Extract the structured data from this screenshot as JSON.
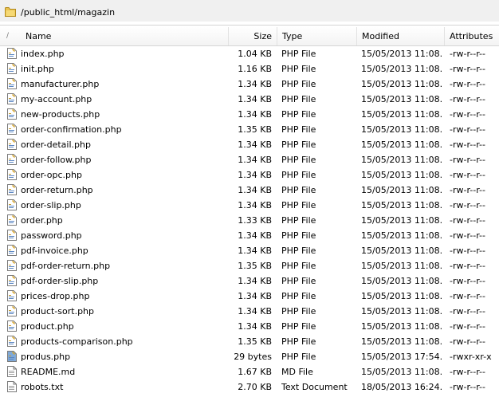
{
  "path": "/public_html/magazin",
  "columns": {
    "name": "Name",
    "size": "Size",
    "type": "Type",
    "modified": "Modified",
    "attributes": "Attributes"
  },
  "files": [
    {
      "name": "index.php",
      "size": "1.04 KB",
      "type": "PHP File",
      "modified": "15/05/2013 11:08...",
      "attributes": "-rw-r--r--",
      "icon": "php-file-icon"
    },
    {
      "name": "init.php",
      "size": "1.16 KB",
      "type": "PHP File",
      "modified": "15/05/2013 11:08...",
      "attributes": "-rw-r--r--",
      "icon": "php-file-icon"
    },
    {
      "name": "manufacturer.php",
      "size": "1.34 KB",
      "type": "PHP File",
      "modified": "15/05/2013 11:08...",
      "attributes": "-rw-r--r--",
      "icon": "php-file-icon"
    },
    {
      "name": "my-account.php",
      "size": "1.34 KB",
      "type": "PHP File",
      "modified": "15/05/2013 11:08...",
      "attributes": "-rw-r--r--",
      "icon": "php-file-icon"
    },
    {
      "name": "new-products.php",
      "size": "1.34 KB",
      "type": "PHP File",
      "modified": "15/05/2013 11:08...",
      "attributes": "-rw-r--r--",
      "icon": "php-file-icon"
    },
    {
      "name": "order-confirmation.php",
      "size": "1.35 KB",
      "type": "PHP File",
      "modified": "15/05/2013 11:08...",
      "attributes": "-rw-r--r--",
      "icon": "php-file-icon"
    },
    {
      "name": "order-detail.php",
      "size": "1.34 KB",
      "type": "PHP File",
      "modified": "15/05/2013 11:08...",
      "attributes": "-rw-r--r--",
      "icon": "php-file-icon"
    },
    {
      "name": "order-follow.php",
      "size": "1.34 KB",
      "type": "PHP File",
      "modified": "15/05/2013 11:08...",
      "attributes": "-rw-r--r--",
      "icon": "php-file-icon"
    },
    {
      "name": "order-opc.php",
      "size": "1.34 KB",
      "type": "PHP File",
      "modified": "15/05/2013 11:08...",
      "attributes": "-rw-r--r--",
      "icon": "php-file-icon"
    },
    {
      "name": "order-return.php",
      "size": "1.34 KB",
      "type": "PHP File",
      "modified": "15/05/2013 11:08...",
      "attributes": "-rw-r--r--",
      "icon": "php-file-icon"
    },
    {
      "name": "order-slip.php",
      "size": "1.34 KB",
      "type": "PHP File",
      "modified": "15/05/2013 11:08...",
      "attributes": "-rw-r--r--",
      "icon": "php-file-icon"
    },
    {
      "name": "order.php",
      "size": "1.33 KB",
      "type": "PHP File",
      "modified": "15/05/2013 11:08...",
      "attributes": "-rw-r--r--",
      "icon": "php-file-icon"
    },
    {
      "name": "password.php",
      "size": "1.34 KB",
      "type": "PHP File",
      "modified": "15/05/2013 11:08...",
      "attributes": "-rw-r--r--",
      "icon": "php-file-icon"
    },
    {
      "name": "pdf-invoice.php",
      "size": "1.34 KB",
      "type": "PHP File",
      "modified": "15/05/2013 11:08...",
      "attributes": "-rw-r--r--",
      "icon": "php-file-icon"
    },
    {
      "name": "pdf-order-return.php",
      "size": "1.35 KB",
      "type": "PHP File",
      "modified": "15/05/2013 11:08...",
      "attributes": "-rw-r--r--",
      "icon": "php-file-icon"
    },
    {
      "name": "pdf-order-slip.php",
      "size": "1.34 KB",
      "type": "PHP File",
      "modified": "15/05/2013 11:08...",
      "attributes": "-rw-r--r--",
      "icon": "php-file-icon"
    },
    {
      "name": "prices-drop.php",
      "size": "1.34 KB",
      "type": "PHP File",
      "modified": "15/05/2013 11:08...",
      "attributes": "-rw-r--r--",
      "icon": "php-file-icon"
    },
    {
      "name": "product-sort.php",
      "size": "1.34 KB",
      "type": "PHP File",
      "modified": "15/05/2013 11:08...",
      "attributes": "-rw-r--r--",
      "icon": "php-file-icon"
    },
    {
      "name": "product.php",
      "size": "1.34 KB",
      "type": "PHP File",
      "modified": "15/05/2013 11:08...",
      "attributes": "-rw-r--r--",
      "icon": "php-file-icon"
    },
    {
      "name": "products-comparison.php",
      "size": "1.35 KB",
      "type": "PHP File",
      "modified": "15/05/2013 11:08...",
      "attributes": "-rw-r--r--",
      "icon": "php-file-icon"
    },
    {
      "name": "produs.php",
      "size": "29 bytes",
      "type": "PHP File",
      "modified": "15/05/2013 17:54...",
      "attributes": "-rwxr-xr-x",
      "icon": "php-file-blue-icon"
    },
    {
      "name": "README.md",
      "size": "1.67 KB",
      "type": "MD File",
      "modified": "15/05/2013 11:08...",
      "attributes": "-rw-r--r--",
      "icon": "document-icon"
    },
    {
      "name": "robots.txt",
      "size": "2.70 KB",
      "type": "Text Document",
      "modified": "18/05/2013 16:24...",
      "attributes": "-rw-r--r--",
      "icon": "text-document-icon"
    }
  ]
}
